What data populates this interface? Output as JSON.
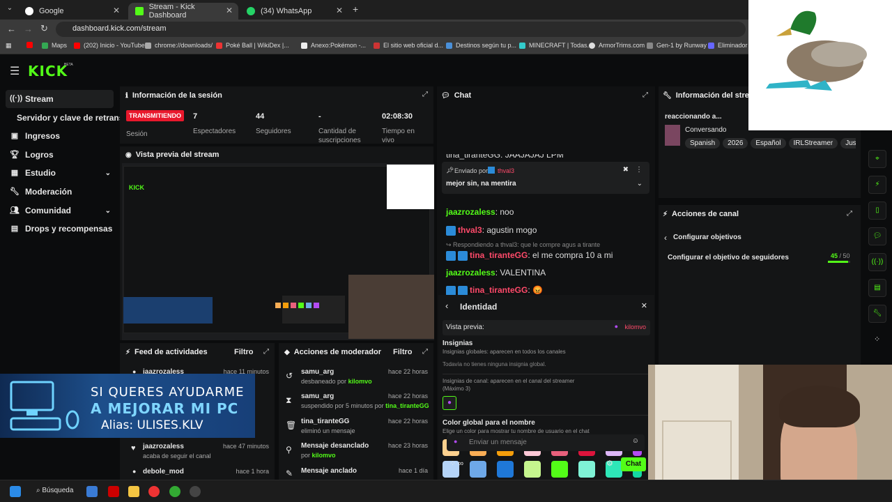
{
  "browser": {
    "tabs": [
      {
        "label": "Google"
      },
      {
        "label": "Stream - Kick Dashboard"
      },
      {
        "label": "(34) WhatsApp"
      }
    ],
    "url": "dashboard.kick.com/stream",
    "bookmarks": [
      "Maps",
      "(202) Inicio - YouTube",
      "chrome://downloads/",
      "Poké Ball | WikiDex |...",
      "Anexo:Pokémon -...",
      "El sitio web oficial d...",
      "Destinos según tu p...",
      "MINECRAFT | Todas...",
      "ArmorTrims.com",
      "Gen-1 by Runway",
      "Eliminador d"
    ]
  },
  "logo": "KICK",
  "logo_badge": "BETA",
  "sidebar": {
    "items": [
      {
        "label": "Stream"
      },
      {
        "label": "Servidor y clave de retransmisión"
      },
      {
        "label": "Ingresos"
      },
      {
        "label": "Logros"
      },
      {
        "label": "Estudio"
      },
      {
        "label": "Moderación"
      },
      {
        "label": "Comunidad"
      },
      {
        "label": "Drops y recompensas"
      }
    ]
  },
  "session": {
    "title": "Información de la sesión",
    "status": "TRANSMITIENDO",
    "status_label": "Sesión",
    "viewers": "7",
    "viewers_label": "Espectadores",
    "followers": "44",
    "followers_label": "Seguidores",
    "subs": "-",
    "subs_label": "Cantidad de suscripciones",
    "time": "02:08:30",
    "time_label": "Tiempo en vivo"
  },
  "preview": {
    "title": "Vista previa del stream"
  },
  "overlay_banner": {
    "line1": "SI QUERES AYUDARME",
    "line2": "A MEJORAR MI PC",
    "line3": "Alias: ULISES.KLV"
  },
  "activity": {
    "title": "Feed de actividades",
    "filter": "Filtro",
    "rows": [
      {
        "user": "jaazrozaless",
        "text": "",
        "time": "hace 11 minutos"
      },
      {
        "user": "jaazrozaless",
        "text": "acaba de seguir el canal",
        "time": "hace 47 minutos"
      },
      {
        "user": "debole_mod",
        "text": "",
        "time": "hace 1 hora"
      }
    ]
  },
  "mod_actions": {
    "title": "Acciones de moderador",
    "filter": "Filtro",
    "rows": [
      {
        "user": "samu_arg",
        "text": "desbaneado por",
        "by": "kilomvo",
        "time": "hace 22 horas"
      },
      {
        "user": "samu_arg",
        "text": "suspendido por 5 minutos por",
        "by": "tina_tiranteGG",
        "time": "hace 22 horas"
      },
      {
        "user": "tina_tiranteGG",
        "text": "eliminó un mensaje",
        "by": "",
        "time": "hace 22 horas"
      },
      {
        "user": "Mensaje desanclado",
        "text": "por",
        "by": "kilomvo",
        "time": "hace 23 horas"
      },
      {
        "user": "Mensaje anclado",
        "text": "",
        "by": "",
        "time": "hace 1 día"
      }
    ]
  },
  "chat": {
    "title": "Chat",
    "top_partial": "tina_tiranteGG: JAAJAJAJ LPM",
    "pinned_by": "Enviado por",
    "pinned_user": "thval3",
    "pinned_msg": "mejor sin, na mentira",
    "messages": [
      {
        "user": "jaazrozaless",
        "text": ": noo"
      },
      {
        "user": "thval3",
        "text": ": agustin mogo"
      },
      {
        "user": "tina_tiranteGG",
        "text": ": el me compra 10 a mi"
      },
      {
        "user": "jaazrozaless",
        "text": ": VALENTINA"
      },
      {
        "user": "tina_tiranteGG",
        "text": ": 😡"
      }
    ],
    "reply_note": "Respondiendo a thval3: que le compre agus a tirante",
    "identity": {
      "title": "Identidad",
      "preview_label": "Vista previa:",
      "preview_user": "kilomvo",
      "badges_title": "Insignias",
      "global_badges": "Insignias globales: aparecen en todos los canales",
      "no_badges": "Todavía no tienes ninguna insignia global.",
      "channel_badges": "Insignias de canal: aparecen en el canal del streamer",
      "max": "(Máximo 3)",
      "color_title": "Color global para el nombre",
      "color_sub": "Elige un color para mostrar tu nombre de usuario en el chat",
      "colors": [
        "#fcd08e",
        "#f8ad55",
        "#f59e0b",
        "#fbc7d6",
        "#e8607c",
        "#dc143c",
        "#ddb5f7",
        "#b24bf3",
        "#b5d4f8",
        "#6ea8e8",
        "#1f78d8",
        "#c5f58e",
        "#53fc18",
        "#7ff2d6",
        "#2ee6b8",
        "#14d8a3"
      ]
    },
    "input_placeholder": "Enviar un mensaje",
    "send_label": "Chat"
  },
  "stream_info": {
    "title": "Información del stream",
    "stream_title": "reaccionando a...",
    "category": "Conversando",
    "tags": [
      "Spanish",
      "2026",
      "Español",
      "IRLStreamer",
      "JustC"
    ]
  },
  "channel_actions": {
    "title": "Acciones de canal",
    "back": "Configurar objetivos",
    "goal_label": "Configurar el objetivo de seguidores",
    "goal_current": "45",
    "goal_total": "/ 50",
    "goal_progress": 0.9
  },
  "taskbar": {
    "search": "Búsqueda"
  }
}
